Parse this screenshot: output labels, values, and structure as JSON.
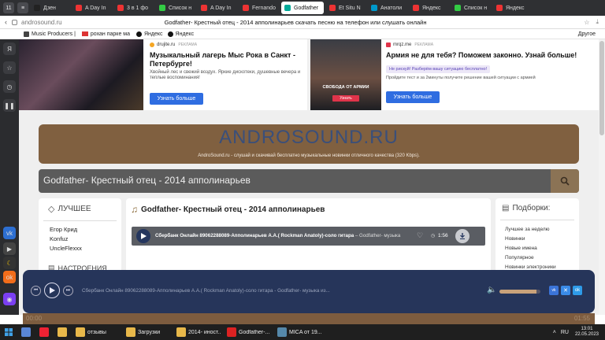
{
  "browser": {
    "tab_count": "11",
    "tabs": [
      {
        "label": "Дзен",
        "color": "#222222"
      },
      {
        "label": "A Day In",
        "color": "#e33"
      },
      {
        "label": "3 в 1 фо",
        "color": "#e33"
      },
      {
        "label": "Список н",
        "color": "#3c4"
      },
      {
        "label": "A Day In",
        "color": "#e33"
      },
      {
        "label": "Fernando",
        "color": "#e33"
      },
      {
        "label": "Godfather",
        "color": "#0a9"
      },
      {
        "label": "Et Situ N",
        "color": "#e33"
      },
      {
        "label": "Анатоли",
        "color": "#09c"
      },
      {
        "label": "Яндекс",
        "color": "#e33"
      },
      {
        "label": "Список н",
        "color": "#3c4"
      },
      {
        "label": "Яндекс",
        "color": "#e33"
      }
    ],
    "address": "androsound.ru",
    "page_title": "Godfather- Крестный отец - 2014 апполинарьев скачать песню на телефон или слушать онлайн",
    "bookmarks": [
      "Music Producers |",
      "рохан парке ма",
      "Яндекс",
      "Яндекс"
    ],
    "other_label": "Другое"
  },
  "ads": {
    "left": {
      "source": "drujite.ru",
      "ad_label": "РЕКЛАМА",
      "title": "Музыкальный лагерь Мыс Рока в Санкт - Петербурге!",
      "text": "Хвойный лес и свежий воздух. Яркие дискотеки, душевные вечера и теплые воспоминания!",
      "button": "Узнать больше"
    },
    "right": {
      "source": "mrqz.me",
      "ad_label": "РЕКЛАМА",
      "title": "Армия не для тебя? Поможем законно. Узнай больше!",
      "badge": "Не рискуй! Разберём вашу ситуацию бесплатно!",
      "text": "Пройдите тест и за 2минуты получите решение вашей ситуации с армией",
      "image_caption": "СВОБОДА ОТ АРМИИ",
      "image_button": "Узнать",
      "button": "Узнать больше"
    }
  },
  "site": {
    "logo": "ANDROSOUND.RU",
    "tagline": "AndroSound.ru - слушай и скачивай бесплатно музыкальные новинки отличного качества (320 Kbps).",
    "search_value": "Godfather- Крестный отец  - 2014 апполинарьев"
  },
  "left_panel": {
    "title": "ЛУЧШЕЕ",
    "items": [
      "Егор Крид",
      "Konfuz",
      "UncleFlexxx"
    ],
    "next_title": "НАСТРОЕНИЯ"
  },
  "main": {
    "title": "Godfather- Крестный отец - 2014 апполинарьев",
    "track_title": "Сбербанк Онлайн 89062288089-Апполинарьев А.А.( Rockman Anatoly)-соло гитара",
    "track_suffix": " – Godfather- музыка",
    "duration": "1:56"
  },
  "right_panel": {
    "title": "Подборки:",
    "items": [
      "Лучшее за неделю",
      "Новинки",
      "Новые имена",
      "Популярное",
      "Новинки электроники"
    ]
  },
  "player": {
    "now_playing": "Сбербанк Онлайн 89062288089-Апполинарьев А.А.( Rockman Anatoly)-соло гитара - Godfather- музыка из...",
    "time_current": "00:00",
    "time_total": "01:55",
    "progress": 0,
    "volume": 0.9
  },
  "taskbar": {
    "items": [
      {
        "label": "отзывы",
        "color": "#e8b84a"
      },
      {
        "label": "Загрузки",
        "color": "#e8b84a"
      },
      {
        "label": "2014- иност...",
        "color": "#e8b84a"
      },
      {
        "label": "Godfather-...",
        "color": "#d22"
      },
      {
        "label": "MICA от 19...",
        "color": "#58a"
      }
    ],
    "lang": "RU",
    "time": "13:01",
    "date": "22.05.2023"
  },
  "colors": {
    "header_brown": "#806040",
    "player_blue": "#26355a",
    "accent_blue": "#2f6de1",
    "dark_gray": "#5b5b5b"
  }
}
